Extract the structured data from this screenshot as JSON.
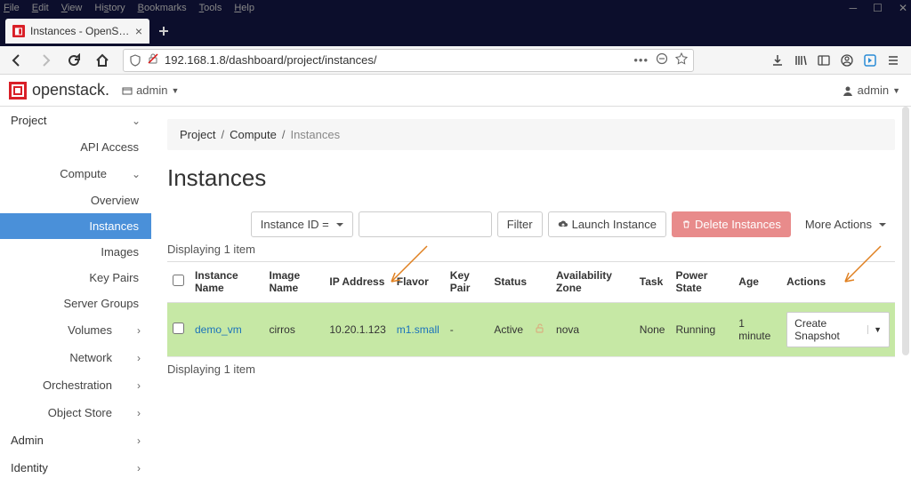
{
  "window": {
    "menu": [
      "File",
      "Edit",
      "View",
      "History",
      "Bookmarks",
      "Tools",
      "Help"
    ],
    "tab_title": "Instances - OpenStack Dashbo",
    "url_display": "192.168.1.8/dashboard/project/instances/"
  },
  "header": {
    "logo_text": "openstack.",
    "project_label": "admin",
    "user_label": "admin"
  },
  "sidebar": {
    "project": "Project",
    "api_access": "API Access",
    "compute": "Compute",
    "overview": "Overview",
    "instances": "Instances",
    "images": "Images",
    "keypairs": "Key Pairs",
    "servergroups": "Server Groups",
    "volumes": "Volumes",
    "network": "Network",
    "orchestration": "Orchestration",
    "objectstore": "Object Store",
    "admin": "Admin",
    "identity": "Identity"
  },
  "breadcrumb": {
    "a": "Project",
    "b": "Compute",
    "c": "Instances"
  },
  "page_title": "Instances",
  "toolbar": {
    "filter_dd": "Instance ID =",
    "filter_btn": "Filter",
    "launch": "Launch Instance",
    "delete": "Delete Instances",
    "more": "More Actions"
  },
  "table": {
    "count_text": "Displaying 1 item",
    "headers": {
      "name": "Instance Name",
      "image": "Image Name",
      "ip": "IP Address",
      "flavor": "Flavor",
      "keypair": "Key Pair",
      "status": "Status",
      "az": "Availability Zone",
      "task": "Task",
      "pstate": "Power State",
      "age": "Age",
      "actions": "Actions"
    },
    "row": {
      "name": "demo_vm",
      "image": "cirros",
      "ip": "10.20.1.123",
      "flavor": "m1.small",
      "keypair": "-",
      "status": "Active",
      "az": "nova",
      "task": "None",
      "pstate": "Running",
      "age": "1 minute",
      "action_btn": "Create Snapshot"
    }
  }
}
